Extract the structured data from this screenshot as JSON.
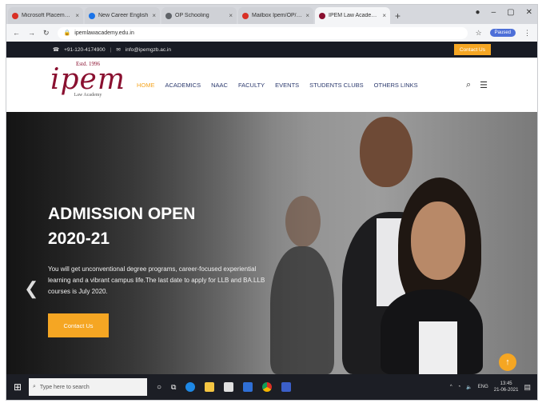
{
  "browser": {
    "tabs": [
      {
        "title": "Microsoft Placement",
        "active": false,
        "color": "#d93025"
      },
      {
        "title": "New Career English",
        "active": false,
        "color": "#1a73e8"
      },
      {
        "title": "OP Schooling",
        "active": false,
        "color": "#5f6368"
      },
      {
        "title": "Mailbox Ipem/OP/bhem",
        "active": false,
        "color": "#d93025"
      },
      {
        "title": "IPEM Law Academy | Best La",
        "active": true,
        "color": "#8a1030"
      }
    ],
    "new_tab": "+",
    "url": "ipemlawacademy.edu.in",
    "profile": "Paused"
  },
  "contact_bar": {
    "phone": "+91-120-4174900",
    "separator": "|",
    "email": "info@ipemgzb.ac.in",
    "contact_button": "Contact Us"
  },
  "header": {
    "logo_est": "Estd. 1996",
    "logo_word": "ipem",
    "logo_sub": "Law Academy",
    "nav": [
      "HOME",
      "ACADEMICS",
      "NAAC",
      "FACULTY",
      "EVENTS",
      "STUDENTS CLUBS",
      "OTHERS LINKS"
    ]
  },
  "hero": {
    "title_line1": "ADMISSION OPEN",
    "title_line2": "2020-21",
    "text": "You will get unconventional degree programs, career-focused experiential learning and a vibrant campus life.The last date to apply for LLB and BA.LLB courses is July 2020.",
    "button": "Contact Us"
  },
  "taskbar": {
    "search_placeholder": "Type here to search",
    "time": "13:45",
    "date": "21-06-2021",
    "lang": "ENG"
  },
  "colors": {
    "accent": "#f5a623",
    "brand": "#8a1030",
    "nav": "#2c3a6e",
    "topbar": "#181b24"
  }
}
